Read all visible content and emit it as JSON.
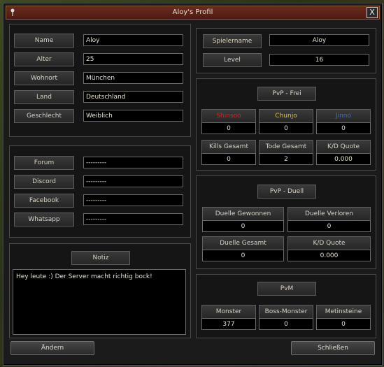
{
  "window": {
    "title": "Aloy's Profil",
    "close_label": "X"
  },
  "profile": {
    "fields": [
      {
        "label": "Name",
        "value": "Aloy"
      },
      {
        "label": "Alter",
        "value": "25"
      },
      {
        "label": "Wohnort",
        "value": "München"
      },
      {
        "label": "Land",
        "value": "Deutschland"
      },
      {
        "label": "Geschlecht",
        "value": "Weiblich"
      }
    ]
  },
  "social": {
    "fields": [
      {
        "label": "Forum",
        "value": "---------"
      },
      {
        "label": "Discord",
        "value": "---------"
      },
      {
        "label": "Facebook",
        "value": "---------"
      },
      {
        "label": "Whatsapp",
        "value": "---------"
      }
    ]
  },
  "notiz": {
    "label": "Notiz",
    "text": "Hey leute :) Der Server macht richtig bock!"
  },
  "player": {
    "name_label": "Spielername",
    "name_value": "Aloy",
    "level_label": "Level",
    "level_value": "16"
  },
  "pvp_frei": {
    "title": "PvP - Frei",
    "kingdoms": [
      {
        "label": "Shinsoo",
        "value": "0",
        "color": "#e0201c"
      },
      {
        "label": "Chunjo",
        "value": "0",
        "color": "#e0c24a"
      },
      {
        "label": "Jinno",
        "value": "0",
        "color": "#2f6fe0"
      }
    ],
    "stats": [
      {
        "label": "Kills Gesamt",
        "value": "0"
      },
      {
        "label": "Tode Gesamt",
        "value": "2"
      },
      {
        "label": "K/D Quote",
        "value": "0.000"
      }
    ]
  },
  "pvp_duell": {
    "title": "PvP - Duell",
    "stats": [
      {
        "label": "Duelle Gewonnen",
        "value": "0"
      },
      {
        "label": "Duelle Verloren",
        "value": "0"
      },
      {
        "label": "Duelle Gesamt",
        "value": "0"
      },
      {
        "label": "K/D Quote",
        "value": "0.000"
      }
    ]
  },
  "pvm": {
    "title": "PvM",
    "stats": [
      {
        "label": "Monster",
        "value": "377"
      },
      {
        "label": "Boss-Monster",
        "value": "0"
      },
      {
        "label": "Metinsteine",
        "value": "0"
      }
    ]
  },
  "buttons": {
    "edit": "Ändern",
    "close": "Schließen"
  }
}
